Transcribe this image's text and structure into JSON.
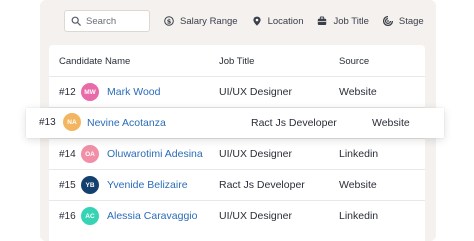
{
  "filters": {
    "search_placeholder": "Search",
    "items": [
      {
        "label": "Salary Range",
        "icon": "dollar-icon"
      },
      {
        "label": "Location",
        "icon": "location-pin-icon"
      },
      {
        "label": "Job Title",
        "icon": "briefcase-icon"
      },
      {
        "label": "Stage",
        "icon": "stage-icon"
      }
    ]
  },
  "table": {
    "columns": [
      "Candidate Name",
      "Job Title",
      "Source"
    ],
    "rows": [
      {
        "num": "#12",
        "initials": "MW",
        "name": "Mark Wood",
        "job": "UI/UX Designer",
        "source": "Website",
        "avatar_color": "#e96aa8"
      },
      {
        "num": "#13",
        "initials": "NA",
        "name": "Nevine Acotanza",
        "job": "Ract Js Developer",
        "source": "Website",
        "avatar_color": "#f2b661"
      },
      {
        "num": "#14",
        "initials": "OA",
        "name": "Oluwarotimi Adesina",
        "job": "UI/UX Designer",
        "source": "Linkedin",
        "avatar_color": "#f08fa6"
      },
      {
        "num": "#15",
        "initials": "YB",
        "name": "Yvenide Belizaire",
        "job": "Ract Js Developer",
        "source": "Website",
        "avatar_color": "#14406f"
      },
      {
        "num": "#16",
        "initials": "AC",
        "name": "Alessia Caravaggio",
        "job": "UI/UX Designer",
        "source": "Linkedin",
        "avatar_color": "#36d3b4"
      }
    ]
  }
}
